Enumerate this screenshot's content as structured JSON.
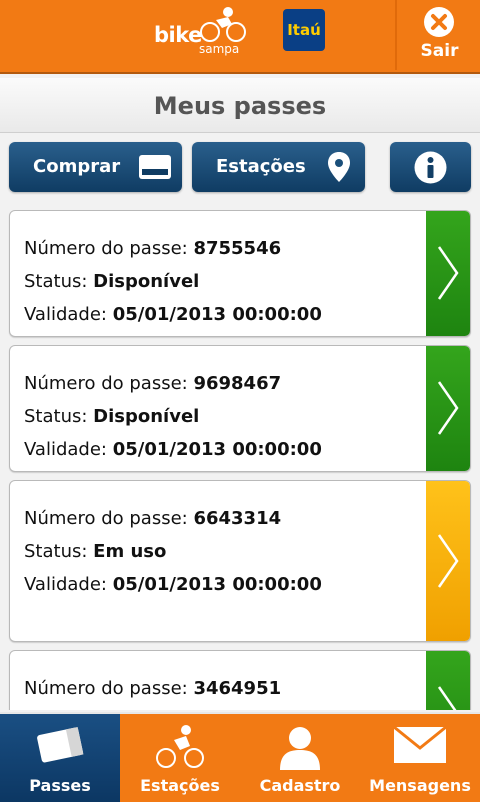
{
  "header": {
    "logo_word": "bike",
    "logo_sub": "sampa",
    "bank_logo": "Itaú",
    "exit_label": "Sair"
  },
  "title": "Meus passes",
  "actions": {
    "buy_label": "Comprar",
    "stations_label": "Estações"
  },
  "passes": [
    {
      "number_label": "Número do passe: ",
      "number": "8755546",
      "status_label": "Status: ",
      "status": "Disponível",
      "validity_label": "Validade: ",
      "validity": "05/01/2013 00:00:00",
      "color": "#2a9a18"
    },
    {
      "number_label": "Número do passe: ",
      "number": "9698467",
      "status_label": "Status: ",
      "status": "Disponível",
      "validity_label": "Validade: ",
      "validity": "05/01/2013 00:00:00",
      "color": "#2a9a18"
    },
    {
      "number_label": "Número do passe: ",
      "number": "6643314",
      "status_label": "Status: ",
      "status": "Em uso",
      "validity_label": "Validade: ",
      "validity": "05/01/2013 00:00:00",
      "color": "#f8b40c"
    },
    {
      "number_label": "Número do passe: ",
      "number": "3464951",
      "color": "#2a9a18"
    }
  ],
  "nav": {
    "passes": "Passes",
    "stations": "Estações",
    "register": "Cadastro",
    "messages": "Mensagens"
  },
  "colors": {
    "brand_orange": "#f27a14",
    "nav_blue": "#0c3763",
    "available_green": "#2a9a18",
    "in_use_amber": "#f8b40c"
  }
}
